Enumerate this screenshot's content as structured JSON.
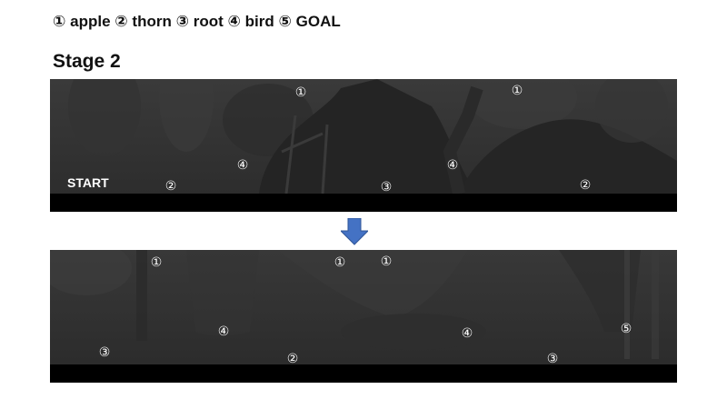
{
  "legend": {
    "items": [
      {
        "symbol": "①",
        "label": "apple"
      },
      {
        "symbol": "②",
        "label": "thorn"
      },
      {
        "symbol": "③",
        "label": "root"
      },
      {
        "symbol": "④",
        "label": "bird"
      },
      {
        "symbol": "⑤",
        "label": "GOAL"
      }
    ]
  },
  "stage": {
    "title": "Stage 2"
  },
  "panel1": {
    "start_label": "START",
    "markers": [
      "①",
      "①",
      "④",
      "④",
      "②",
      "③",
      "②"
    ]
  },
  "panel2": {
    "markers": [
      "①",
      "①",
      "①",
      "④",
      "④",
      "⑤",
      "③",
      "②",
      "③"
    ]
  },
  "colors": {
    "panel_bg": "#2f2f2f",
    "ground": "#000000",
    "arrow": "#4472c4",
    "marker_text": "#ffffff"
  },
  "icons": {
    "transition_arrow": "arrow-down-icon"
  }
}
